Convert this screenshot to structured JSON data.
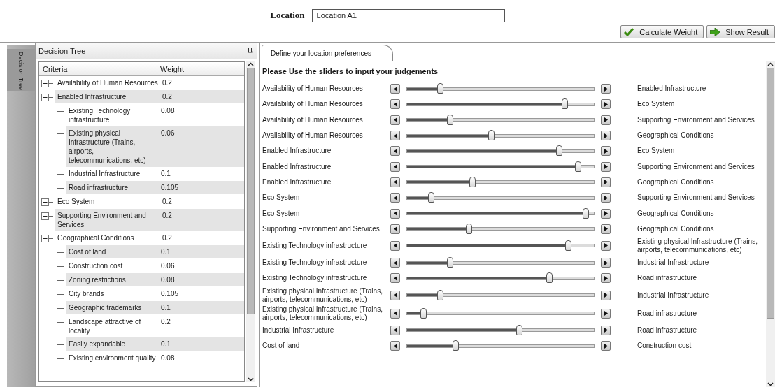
{
  "location": {
    "label": "Location",
    "value": "Location A1"
  },
  "buttons": [
    {
      "label": "Calculate Weight",
      "kind": "check"
    },
    {
      "label": "Show Result",
      "kind": "arrow"
    }
  ],
  "side_tab": {
    "label": "Decision Tree"
  },
  "tree_panel": {
    "title": "Decision Tree",
    "columns": [
      "Criteria",
      "Weight"
    ],
    "items": [
      {
        "name": "Availability of Human Resources",
        "weight": "0.2",
        "expanded": false
      },
      {
        "name": "Enabled Infrastructure",
        "weight": "0.2",
        "expanded": true,
        "children": [
          {
            "name": "Existing Technology infrastructure",
            "weight": "0.08"
          },
          {
            "name": "Existing physical Infrastructure (Trains, airports, telecommunications, etc)",
            "weight": "0.06"
          },
          {
            "name": "Industrial Infrastructure",
            "weight": "0.1"
          },
          {
            "name": "Road infrastructure",
            "weight": "0.105"
          }
        ]
      },
      {
        "name": "Eco System",
        "weight": "0.2",
        "expanded": false
      },
      {
        "name": "Supporting Environment and Services",
        "weight": "0.2",
        "expanded": false
      },
      {
        "name": "Geographical Conditions",
        "weight": "0.2",
        "expanded": true,
        "children": [
          {
            "name": "Cost of land",
            "weight": "0.1"
          },
          {
            "name": "Construction cost",
            "weight": "0.06"
          },
          {
            "name": "Zoning restrictions",
            "weight": "0.08"
          },
          {
            "name": "City brands",
            "weight": "0.105"
          },
          {
            "name": "Geographic trademarks",
            "weight": "0.1"
          },
          {
            "name": "Landscape attractive of locality",
            "weight": "0.2"
          },
          {
            "name": "Easily expandable",
            "weight": "0.1"
          },
          {
            "name": "Existing environment quality",
            "weight": "0.08"
          }
        ]
      }
    ]
  },
  "tabs": [
    {
      "label": "Define your location preferences",
      "selected": true
    }
  ],
  "heading": "Please Use the sliders to input your judgements",
  "comparisons": [
    {
      "left": "Availability of Human Resources",
      "right": "Enabled Infrastructure",
      "level": 0.18
    },
    {
      "left": "Availability of Human Resources",
      "right": "Eco System",
      "level": 0.84
    },
    {
      "left": "Availability of Human Resources",
      "right": "Supporting Environment and Services",
      "level": 0.23
    },
    {
      "left": "Availability of Human Resources",
      "right": "Geographical Conditions",
      "level": 0.45
    },
    {
      "left": "Enabled Infrastructure",
      "right": "Eco System",
      "level": 0.81
    },
    {
      "left": "Enabled Infrastructure",
      "right": "Supporting Environment and Services",
      "level": 0.91
    },
    {
      "left": "Enabled Infrastructure",
      "right": "Geographical Conditions",
      "level": 0.35
    },
    {
      "left": "Eco System",
      "right": "Supporting Environment and Services",
      "level": 0.13
    },
    {
      "left": "Eco System",
      "right": "Geographical Conditions",
      "level": 0.95
    },
    {
      "left": "Supporting Environment and Services",
      "right": "Geographical Conditions",
      "level": 0.33
    },
    {
      "left": "Existing Technology infrastructure",
      "right": "Existing physical Infrastructure (Trains, airports, telecommunications, etc)",
      "level": 0.86
    },
    {
      "left": "Existing Technology infrastructure",
      "right": "Industrial Infrastructure",
      "level": 0.23
    },
    {
      "left": "Existing Technology infrastructure",
      "right": "Road infrastructure",
      "level": 0.76
    },
    {
      "left": "Existing physical Infrastructure (Trains, airports, telecommunications, etc)",
      "right": "Industrial Infrastructure",
      "level": 0.18
    },
    {
      "left": "Existing physical Infrastructure (Trains, airports, telecommunications, etc)",
      "right": "Road infrastructure",
      "level": 0.09
    },
    {
      "left": "Industrial Infrastructure",
      "right": "Road infrastructure",
      "level": 0.6
    },
    {
      "left": "Cost of land",
      "right": "Construction cost",
      "level": 0.26
    }
  ]
}
